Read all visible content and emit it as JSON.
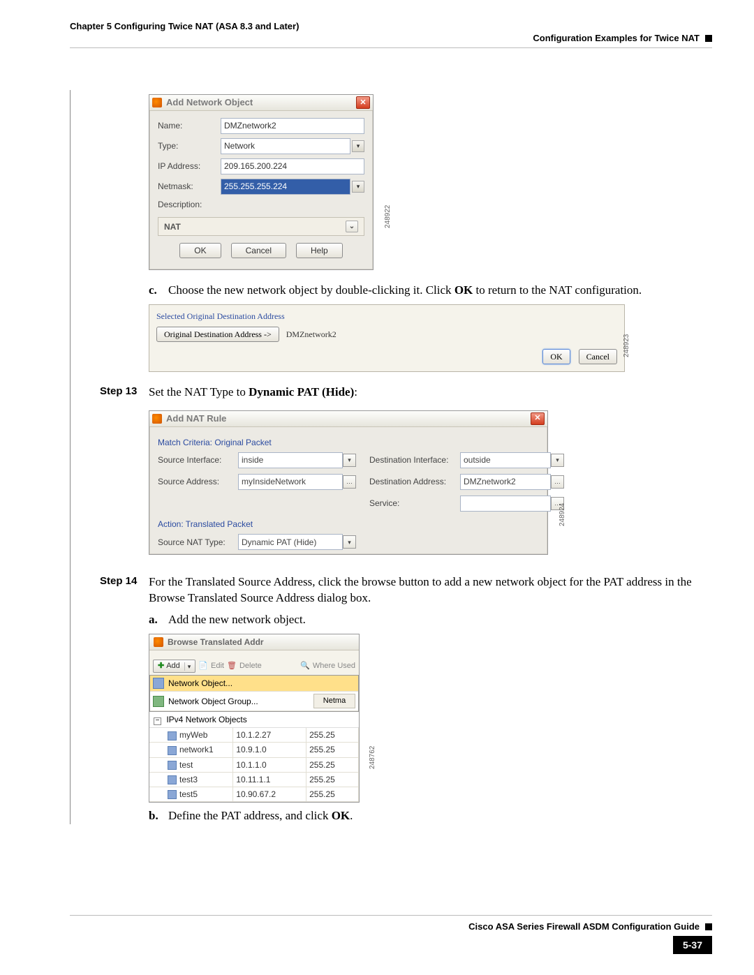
{
  "header": {
    "chapter": "Chapter 5    Configuring Twice NAT (ASA 8.3 and Later)",
    "section": "Configuration Examples for Twice NAT"
  },
  "dialog1": {
    "title": "Add Network Object",
    "fields": {
      "name_label": "Name:",
      "name_value": "DMZnetwork2",
      "type_label": "Type:",
      "type_value": "Network",
      "ip_label": "IP Address:",
      "ip_value": "209.165.200.224",
      "mask_label": "Netmask:",
      "mask_value": "255.255.255.224",
      "desc_label": "Description:"
    },
    "nat_label": "NAT",
    "buttons": {
      "ok": "OK",
      "cancel": "Cancel",
      "help": "Help"
    },
    "fig_id": "248922"
  },
  "text_c": {
    "label": "c.",
    "pre": "Choose the new network object by double-clicking it. Click ",
    "bold": "OK",
    "post": " to return to the NAT configuration."
  },
  "sel_panel": {
    "group": "Selected Original Destination Address",
    "btn": "Original Destination Address ->",
    "value": "DMZnetwork2",
    "ok": "OK",
    "cancel": "Cancel",
    "fig_id": "248923"
  },
  "step13": {
    "label": "Step 13",
    "pre": "Set the NAT Type to ",
    "bold": "Dynamic PAT (Hide)",
    "post": ":"
  },
  "nat_rule": {
    "title": "Add NAT Rule",
    "section1": "Match Criteria: Original Packet",
    "src_if_label": "Source Interface:",
    "src_if_value": "inside",
    "dst_if_label": "Destination Interface:",
    "dst_if_value": "outside",
    "src_addr_label": "Source Address:",
    "src_addr_value": "myInsideNetwork",
    "dst_addr_label": "Destination Address:",
    "dst_addr_value": "DMZnetwork2",
    "svc_label": "Service:",
    "svc_value": "",
    "section2": "Action: Translated Packet",
    "nat_type_label": "Source NAT Type:",
    "nat_type_value": "Dynamic PAT (Hide)",
    "fig_id": "248924"
  },
  "step14": {
    "label": "Step 14",
    "text": "For the Translated Source Address, click the browse button to add a new network object for the PAT address in the Browse Translated Source Address dialog box."
  },
  "sub_a": {
    "label": "a.",
    "text": "Add the new network object."
  },
  "browse": {
    "title": "Browse Translated Addr",
    "add": "Add",
    "edit": "Edit",
    "delete": "Delete",
    "where": "Where Used",
    "menu1": "Network Object...",
    "menu2": "Network Object Group...",
    "col_netmask": "Netma",
    "tree_header": "IPv4 Network Objects",
    "rows": [
      {
        "name": "myWeb",
        "ip": "10.1.2.27",
        "mask": "255.25"
      },
      {
        "name": "network1",
        "ip": "10.9.1.0",
        "mask": "255.25"
      },
      {
        "name": "test",
        "ip": "10.1.1.0",
        "mask": "255.25"
      },
      {
        "name": "test3",
        "ip": "10.11.1.1",
        "mask": "255.25"
      },
      {
        "name": "test5",
        "ip": "10.90.67.2",
        "mask": "255.25"
      }
    ],
    "fig_id": "248762"
  },
  "sub_b": {
    "label": "b.",
    "pre": "Define the PAT address, and click ",
    "bold": "OK",
    "post": "."
  },
  "footer": {
    "guide": "Cisco ASA Series Firewall ASDM Configuration Guide",
    "page": "5-37"
  }
}
